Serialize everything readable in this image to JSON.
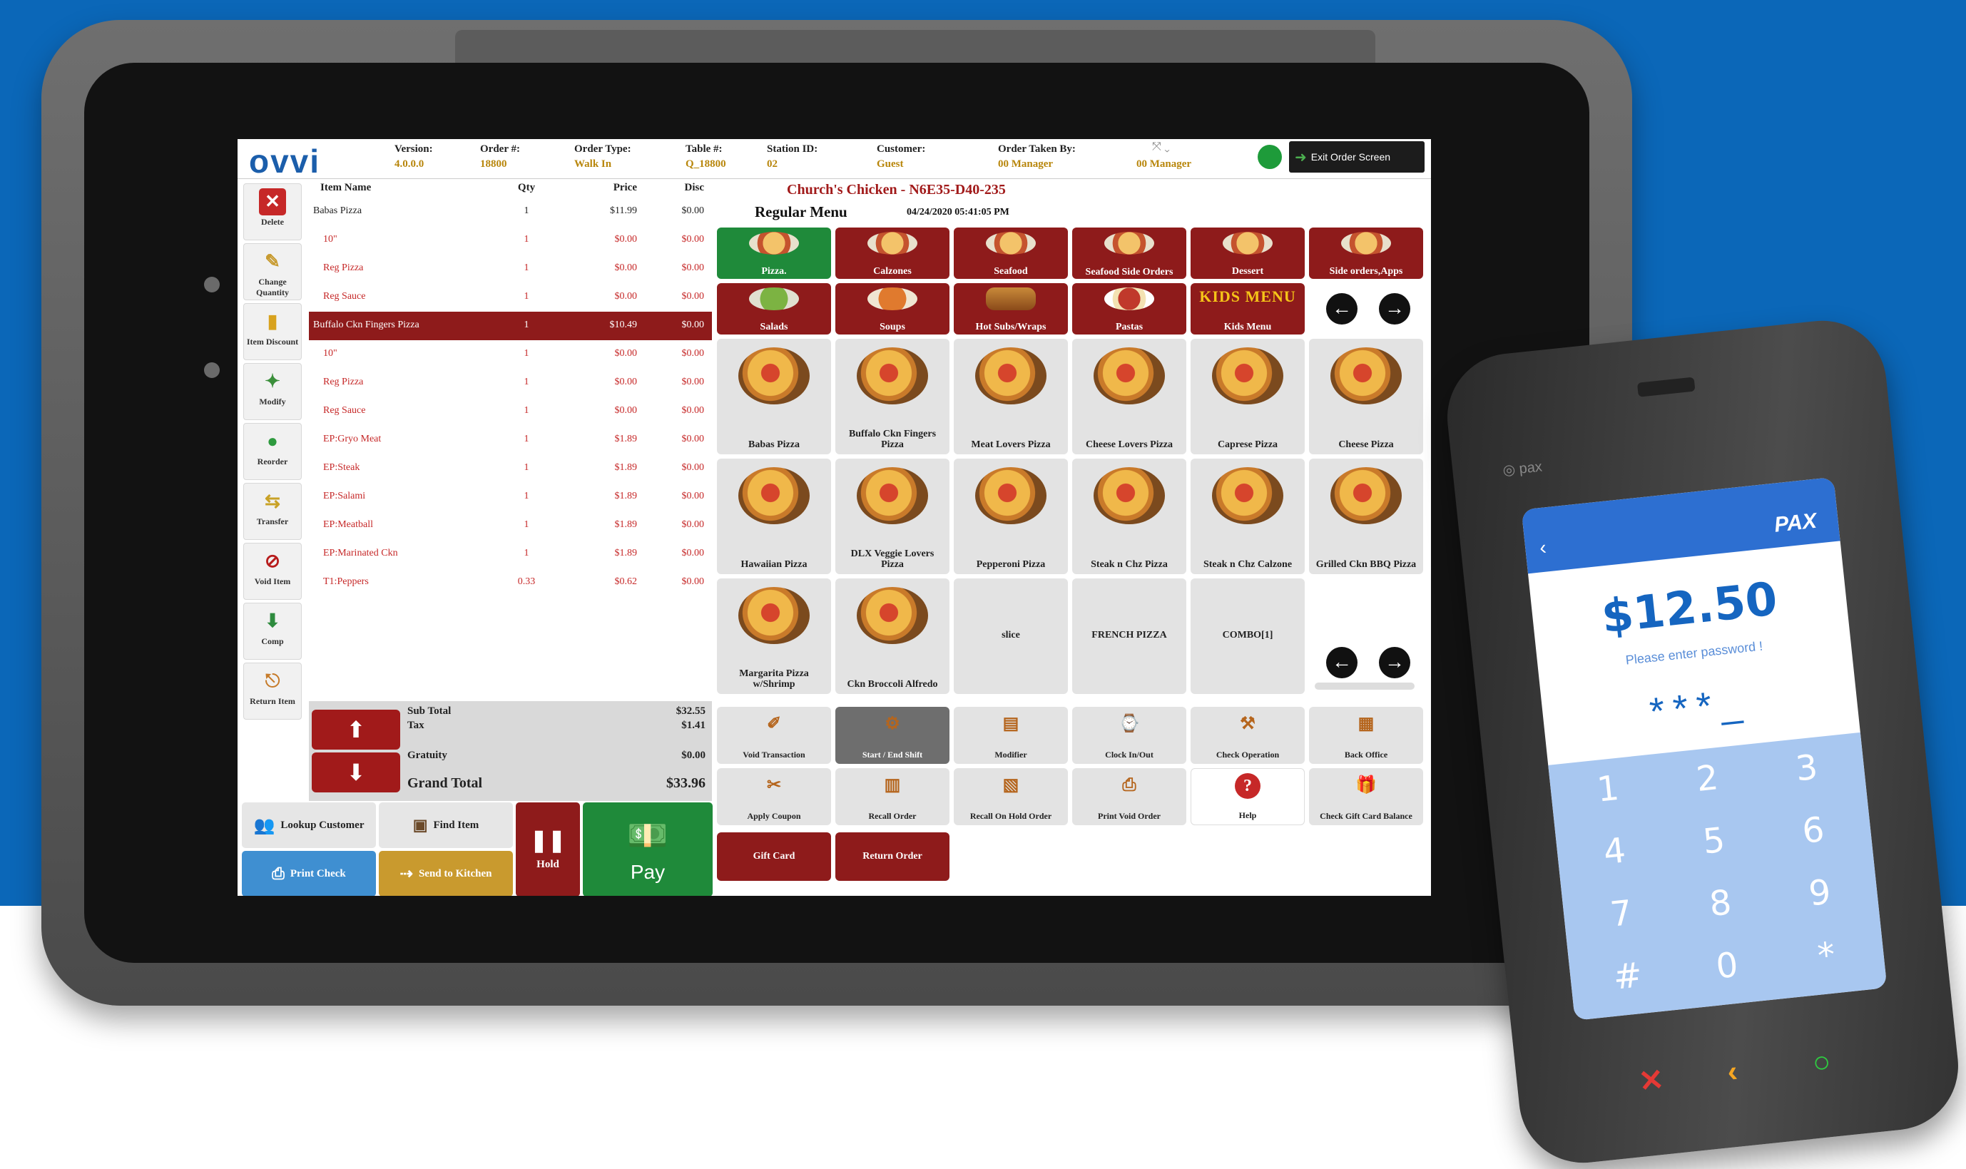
{
  "header": {
    "logo": "ovvi",
    "fields": [
      {
        "label": "Version:",
        "value": "4.0.0.0"
      },
      {
        "label": "Order #:",
        "value": "18800"
      },
      {
        "label": "Order Type:",
        "value": "Walk In"
      },
      {
        "label": "Table #:",
        "value": "Q_18800"
      },
      {
        "label": "Station ID:",
        "value": "02"
      },
      {
        "label": "Customer:",
        "value": "Guest"
      },
      {
        "label": "Order Taken By:",
        "value": "00 Manager"
      }
    ],
    "extra_value": "00 Manager",
    "status_color": "#1e9b3a",
    "exit_label": "Exit Order Screen"
  },
  "sidebar": [
    {
      "label": "Delete",
      "icon": "x-icon"
    },
    {
      "label": "Change Quantity",
      "icon": "pencil-icon"
    },
    {
      "label": "Item Discount",
      "icon": "tag-icon"
    },
    {
      "label": "Modify",
      "icon": "modify-icon"
    },
    {
      "label": "Reorder",
      "icon": "globe-icon"
    },
    {
      "label": "Transfer",
      "icon": "transfer-icon"
    },
    {
      "label": "Void Item",
      "icon": "void-icon"
    },
    {
      "label": "Comp",
      "icon": "comp-icon"
    },
    {
      "label": "Return Item",
      "icon": "return-icon"
    }
  ],
  "order": {
    "columns": {
      "name": "Item Name",
      "qty": "Qty",
      "price": "Price",
      "disc": "Disc"
    },
    "rows": [
      {
        "name": "Babas Pizza",
        "qty": "1",
        "price": "$11.99",
        "disc": "$0.00",
        "kind": "main"
      },
      {
        "name": "10\"",
        "qty": "1",
        "price": "$0.00",
        "disc": "$0.00",
        "kind": "mod"
      },
      {
        "name": "Reg Pizza",
        "qty": "1",
        "price": "$0.00",
        "disc": "$0.00",
        "kind": "mod"
      },
      {
        "name": "Reg Sauce",
        "qty": "1",
        "price": "$0.00",
        "disc": "$0.00",
        "kind": "mod"
      },
      {
        "name": "Buffalo Ckn Fingers Pizza",
        "qty": "1",
        "price": "$10.49",
        "disc": "$0.00",
        "kind": "selected"
      },
      {
        "name": "10\"",
        "qty": "1",
        "price": "$0.00",
        "disc": "$0.00",
        "kind": "mod"
      },
      {
        "name": "Reg Pizza",
        "qty": "1",
        "price": "$0.00",
        "disc": "$0.00",
        "kind": "mod"
      },
      {
        "name": "Reg Sauce",
        "qty": "1",
        "price": "$0.00",
        "disc": "$0.00",
        "kind": "mod"
      },
      {
        "name": "EP:Gryo Meat",
        "qty": "1",
        "price": "$1.89",
        "disc": "$0.00",
        "kind": "mod"
      },
      {
        "name": "EP:Steak",
        "qty": "1",
        "price": "$1.89",
        "disc": "$0.00",
        "kind": "mod"
      },
      {
        "name": "EP:Salami",
        "qty": "1",
        "price": "$1.89",
        "disc": "$0.00",
        "kind": "mod"
      },
      {
        "name": "EP:Meatball",
        "qty": "1",
        "price": "$1.89",
        "disc": "$0.00",
        "kind": "mod"
      },
      {
        "name": "EP:Marinated Ckn",
        "qty": "1",
        "price": "$1.89",
        "disc": "$0.00",
        "kind": "mod"
      },
      {
        "name": "T1:Peppers",
        "qty": "0.33",
        "price": "$0.62",
        "disc": "$0.00",
        "kind": "mod"
      }
    ]
  },
  "totals": {
    "subtotal_label": "Sub Total",
    "subtotal": "$32.55",
    "tax_label": "Tax",
    "tax": "$1.41",
    "gratuity_label": "Gratuity",
    "gratuity": "$0.00",
    "grand_label": "Grand Total",
    "grand": "$33.96"
  },
  "bottom_left": {
    "lookup": "Lookup Customer",
    "find": "Find Item",
    "hold": "Hold",
    "pay": "Pay",
    "print": "Print Check",
    "send": "Send to Kitchen"
  },
  "menu": {
    "restaurant": "Church's Chicken - N6E35-D40-235",
    "name": "Regular Menu",
    "datetime": "04/24/2020 05:41:05 PM",
    "categories": [
      "Pizza.",
      "Calzones",
      "Seafood",
      "Seafood Side Orders",
      "Dessert",
      "Side orders,Apps",
      "Salads",
      "Soups",
      "Hot Subs/Wraps",
      "Pastas",
      "Kids Menu"
    ],
    "kids_badge": "KIDS MENU",
    "items": [
      "Babas Pizza",
      "Buffalo Ckn Fingers Pizza",
      "Meat Lovers Pizza",
      "Cheese Lovers Pizza",
      "Caprese Pizza",
      "Cheese Pizza",
      "Hawaiian Pizza",
      "DLX Veggie Lovers Pizza",
      "Pepperoni Pizza",
      "Steak n Chz Pizza",
      "Steak n Chz Calzone",
      "Grilled Ckn BBQ Pizza",
      "Margarita Pizza w/Shrimp",
      "Ckn Broccoli Alfredo",
      "slice",
      "FRENCH PIZZA",
      "COMBO[1]"
    ]
  },
  "functions": [
    {
      "label": "Void Transaction",
      "icon": "void-transaction-icon",
      "style": "normal"
    },
    {
      "label": "Start / End Shift",
      "icon": "shift-icon",
      "style": "dark"
    },
    {
      "label": "Modifier",
      "icon": "modifier-icon",
      "style": "normal"
    },
    {
      "label": "Clock In/Out",
      "icon": "clock-icon",
      "style": "normal"
    },
    {
      "label": "Check Operation",
      "icon": "check-operation-icon",
      "style": "normal"
    },
    {
      "label": "Back Office",
      "icon": "back-office-icon",
      "style": "normal"
    },
    {
      "label": "Apply Coupon",
      "icon": "coupon-icon",
      "style": "normal"
    },
    {
      "label": "Recall Order",
      "icon": "recall-icon",
      "style": "normal"
    },
    {
      "label": "Recall On Hold Order",
      "icon": "recall-hold-icon",
      "style": "normal"
    },
    {
      "label": "Print Void Order",
      "icon": "print-void-icon",
      "style": "normal"
    },
    {
      "label": "Help",
      "icon": "help-icon",
      "style": "white"
    },
    {
      "label": "Check Gift Card Balance",
      "icon": "gift-card-balance-icon",
      "style": "normal"
    }
  ],
  "red_buttons": [
    "Gift Card",
    "Return Order"
  ],
  "terminal": {
    "brand": "PAX",
    "amount": "$12.50",
    "prompt": "Please enter password !",
    "password_mask": "***_",
    "keys": [
      "1",
      "2",
      "3",
      "4",
      "5",
      "6",
      "7",
      "8",
      "9",
      "#",
      "0",
      "*"
    ]
  },
  "colors": {
    "accent_red": "#8e1b1b",
    "accent_green": "#1f8a3a",
    "logo_blue": "#1b5eab"
  }
}
